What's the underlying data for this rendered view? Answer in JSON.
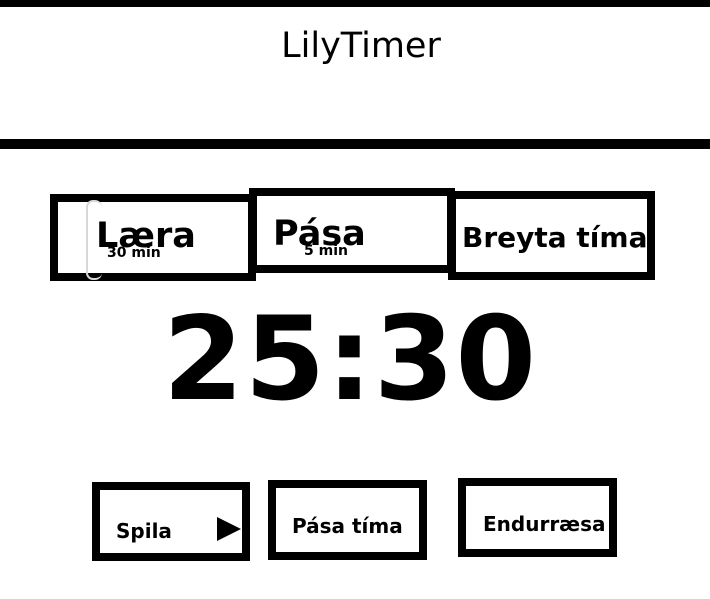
{
  "app": {
    "title": "LilyTimer"
  },
  "modes": {
    "study": {
      "label": "Læra",
      "duration": "30 min"
    },
    "break": {
      "label": "Pása",
      "duration": "5 min"
    },
    "change_time": {
      "label": "Breyta tíma"
    }
  },
  "timer": {
    "display": "25:30"
  },
  "controls": {
    "play_label": "Spila",
    "play_icon": "play-triangle-icon",
    "pause_label": "Pása tíma",
    "restart_label": "Endurræsa"
  },
  "colors": {
    "foreground": "#000000",
    "background": "#ffffff"
  }
}
